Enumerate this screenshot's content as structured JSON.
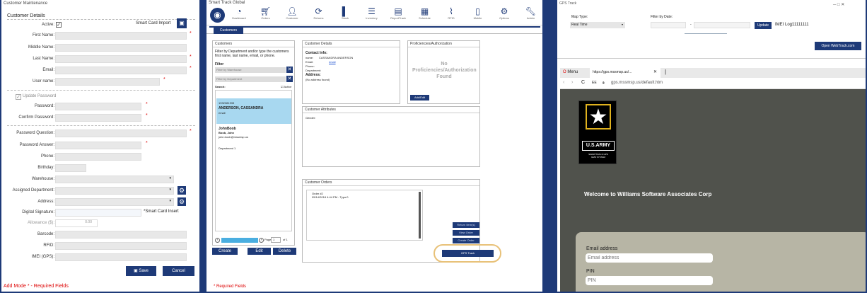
{
  "p1": {
    "title": "Customer Maintenance",
    "section": "Customer Details",
    "active_label": "Active:",
    "smart_card_import": "Smart Card Import",
    "fields": [
      "First Name:",
      "Middle Name:",
      "Last Name:",
      "Email:",
      "User name:"
    ],
    "update_password": "Update Password",
    "password": "Password:",
    "confirm_password": "Confirm Password:",
    "password_question": "Password Question:",
    "password_answer": "Password Answer:",
    "phone": "Phone:",
    "birthday": "Birthday:",
    "warehouse": "Warehouse:",
    "assigned_department": "Assigned Department:",
    "address": "Address:",
    "digital_signature": "Digital Signature:",
    "smart_card_insert": "*Smart Card Insert",
    "allowance": "Allowance ($):",
    "allowance_value": "0.00",
    "barcode": "Barcode:",
    "rfid": "RFID:",
    "imei": "IMEI (GPS):",
    "save": "Save",
    "cancel": "Cancel",
    "footer": "Add Mode   * - Required Fields",
    "colors": {
      "brand": "#1e3a78",
      "required": "#dd0000"
    }
  },
  "p2": {
    "title": "Smart Track Global",
    "toolbar": [
      "Dashboard",
      "Orders",
      "Customer",
      "Returns",
      "Stock",
      "Inventory",
      "ReportTrack",
      "Schedule",
      "RFID",
      "Mobile",
      "Options",
      "Admin"
    ],
    "tab": "Customers",
    "customers_box": "Customers",
    "filter_help": "Filter by Department and/or type the customers first name, last name, email, or phone.",
    "filter": "Filter",
    "filter_warehouse": "Filter by Warehouse",
    "filter_department": "Filter by Department",
    "search": "Search:",
    "active": "Active",
    "sel_id": "1932381933",
    "sel_name": "ANDERSON, CASSANDRA",
    "sel_email": "email",
    "item_user": "JohnBoob",
    "item_name": "Boob, John",
    "item_email": "john.boob@mssmsp.us",
    "item_dept": "Department 1",
    "page_label": "Page",
    "page_value": "1",
    "page_of": "of 1",
    "create": "Create",
    "edit": "Edit",
    "delete": "Delete",
    "details_box": "Customer Details",
    "contact_info": "Contact Info:",
    "name_label": "name:",
    "name_value": "CASSANDRA ANDERSON",
    "email_label": "Email:",
    "email_value": "email",
    "phone_label": "Phone:",
    "department_label": "Department:",
    "address_label": "Address:",
    "no_address": "(No address found)",
    "prof_box": "Proficiencies/Authorization",
    "no_prof": "No Proficiencies/Authorization Found",
    "add_edit": "Add/Edit",
    "attr_box": "Customer Attributes",
    "gender": "Gender:",
    "orders_box": "Customer Orders",
    "order_num": "Order #2",
    "order_date": "05/14/2018 4:44 PM - Typo:0",
    "return_items": "Return Item(s)",
    "view_order": "View Order",
    "create_order": "Create Order",
    "gps_track": "GPS Track",
    "required": "* Required Fields"
  },
  "p3": {
    "title": "GPS Track",
    "map_type": "Map Type:",
    "map_value": "Real Time",
    "filter_date": "Filter by Date:",
    "update": "Update",
    "imei_log": "IMEI Log:",
    "imei_value": "11111111",
    "open_btn": "Open WebTrack.com",
    "browser_menu": "Menu",
    "tab_url": "https://gps.mssmsp.us/...",
    "address_bar": "gps.mssmsp.us/default.htm",
    "ee": "EE",
    "logo_text": "U.S.ARMY",
    "logo_sub": "SMARTTRACK GPS\nGMS SYSTEM",
    "welcome": "Welcome to Williams Software Associates Corp",
    "email_label": "Email address",
    "email_placeholder": "Email address",
    "pin_label": "PIN",
    "pin_placeholder": "PIN"
  }
}
